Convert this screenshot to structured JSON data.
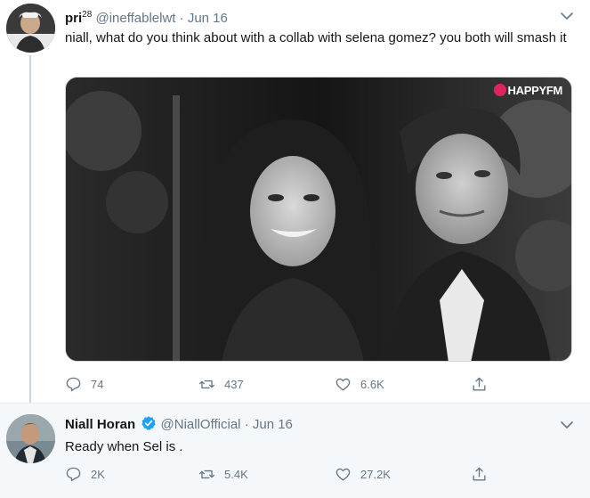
{
  "tweets": [
    {
      "name": "pri",
      "name_sup": "28",
      "handle": "@ineffablelwt",
      "separator": "·",
      "date": "Jun 16",
      "text": "niall, what do you think about with a collab with selena gomez? you both will smash it",
      "media": {
        "watermark": "HAPPYFM"
      },
      "actions": {
        "replies": "74",
        "retweets": "437",
        "likes": "6.6K"
      }
    },
    {
      "name": "Niall Horan",
      "verified": true,
      "handle": "@NiallOfficial",
      "separator": "·",
      "date": "Jun 16",
      "text": "Ready when Sel is .",
      "actions": {
        "replies": "2K",
        "retweets": "5.4K",
        "likes": "27.2K"
      }
    }
  ],
  "icons": {
    "reply": "reply-icon",
    "retweet": "retweet-icon",
    "like": "heart-icon",
    "share": "share-icon",
    "menu": "chevron-down-icon",
    "verified": "verified-badge-icon"
  },
  "colors": {
    "secondary_text": "#657786",
    "verified_blue": "#1da1f2",
    "thread_line": "#ccd6dd",
    "reply_background": "#f5f8fa",
    "watermark_logo": "#e0245e"
  }
}
